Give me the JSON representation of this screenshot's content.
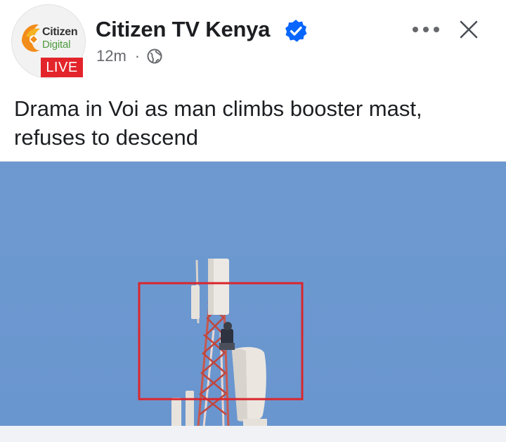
{
  "post": {
    "page_name": "Citizen TV Kenya",
    "verified": true,
    "timestamp": "12m",
    "separator": "·",
    "audience_icon": "globe-icon",
    "headline": "Drama in Voi as man climbs booster mast, refuses to descend"
  },
  "avatar": {
    "logo_line1": "Citizen",
    "logo_line2": "Digital",
    "badge": "LIVE"
  },
  "actions": {
    "more_icon": "more-horizontal-icon",
    "close_icon": "close-icon"
  },
  "photo": {
    "subject": "booster-mast-photo",
    "highlight_box": true
  },
  "colors": {
    "accent_blue": "#0866ff",
    "live_red": "#e3242b",
    "sky": "#6b97cf",
    "highlight_red": "#d9262c",
    "text_primary": "#1c1e21",
    "text_secondary": "#65676b"
  }
}
